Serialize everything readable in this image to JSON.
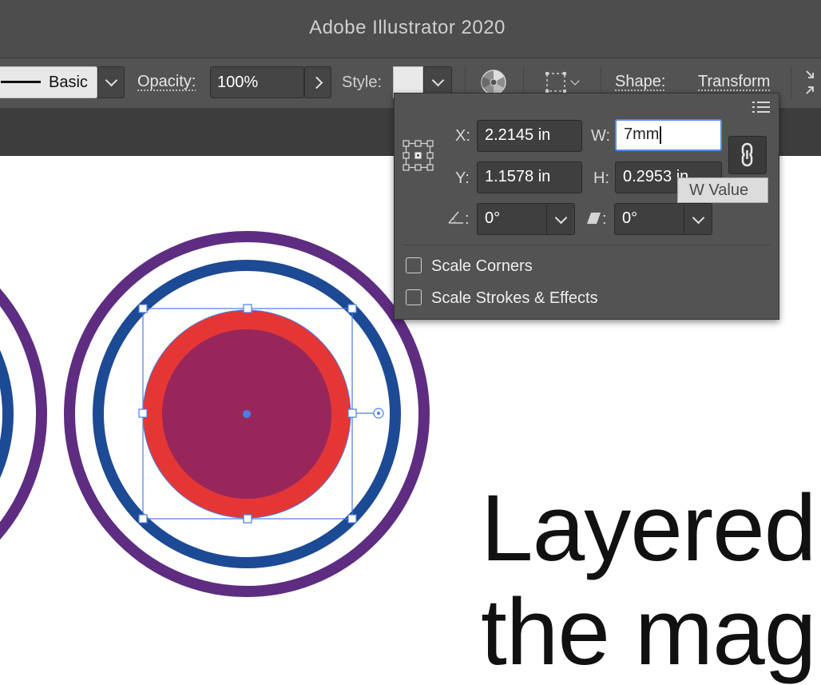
{
  "window": {
    "title": "Adobe Illustrator 2020"
  },
  "controlbar": {
    "stroke_profile_label": "Basic",
    "opacity_label": "Opacity:",
    "opacity_value": "100%",
    "style_label": "Style:",
    "shape_label": "Shape:",
    "transform_label": "Transform"
  },
  "transform_panel": {
    "x_label": "X:",
    "x_value": "2.2145 in",
    "y_label": "Y:",
    "y_value": "1.1578 in",
    "w_label": "W:",
    "w_value": "7mm",
    "h_label": "H:",
    "h_value": "0.2953 in",
    "rotate_value": "0°",
    "shear_value": "0°",
    "scale_corners_label": "Scale Corners",
    "scale_strokes_label": "Scale Strokes & Effects",
    "scale_corners_checked": false,
    "scale_strokes_checked": false
  },
  "tooltip": {
    "text": "W Value"
  },
  "canvas": {
    "headline_line1": "Layered",
    "headline_line2": "the mag",
    "colors": {
      "outer_ring": "#5e2d82",
      "middle_ring": "#1d4a94",
      "fill_red": "#e53636",
      "fill_inner": "#98265b",
      "selection": "#4a7de8"
    }
  }
}
